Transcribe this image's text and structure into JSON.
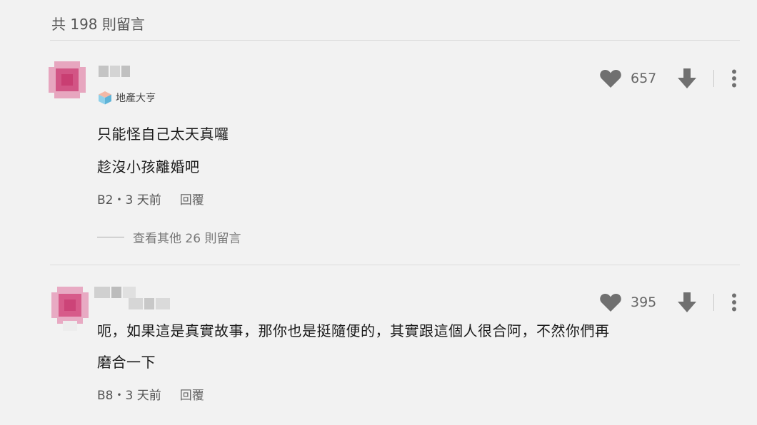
{
  "header": {
    "comment_count": "共 198 則留言"
  },
  "comments": [
    {
      "badge_label": "地產大亨",
      "lines": [
        "只能怪自己太天真囉",
        "趁沒小孩離婚吧"
      ],
      "floor_time": "B2・3 天前",
      "reply_label": "回覆",
      "more_replies": "查看其他 26 則留言",
      "likes": "657"
    },
    {
      "lines": [
        "呃，如果這是真實故事，那你也是挺隨便的，其實跟這個人很合阿，不然你們再",
        "磨合一下"
      ],
      "floor_time": "B8・3 天前",
      "reply_label": "回覆",
      "likes": "395"
    }
  ],
  "colors": {
    "avatar_pink": "#d94f7e",
    "icon_gray": "#707070",
    "badge_cube": "#7ec8e3"
  },
  "icons": [
    "heart-icon",
    "downvote-arrow-icon",
    "more-options-icon",
    "badge-cube-icon"
  ]
}
